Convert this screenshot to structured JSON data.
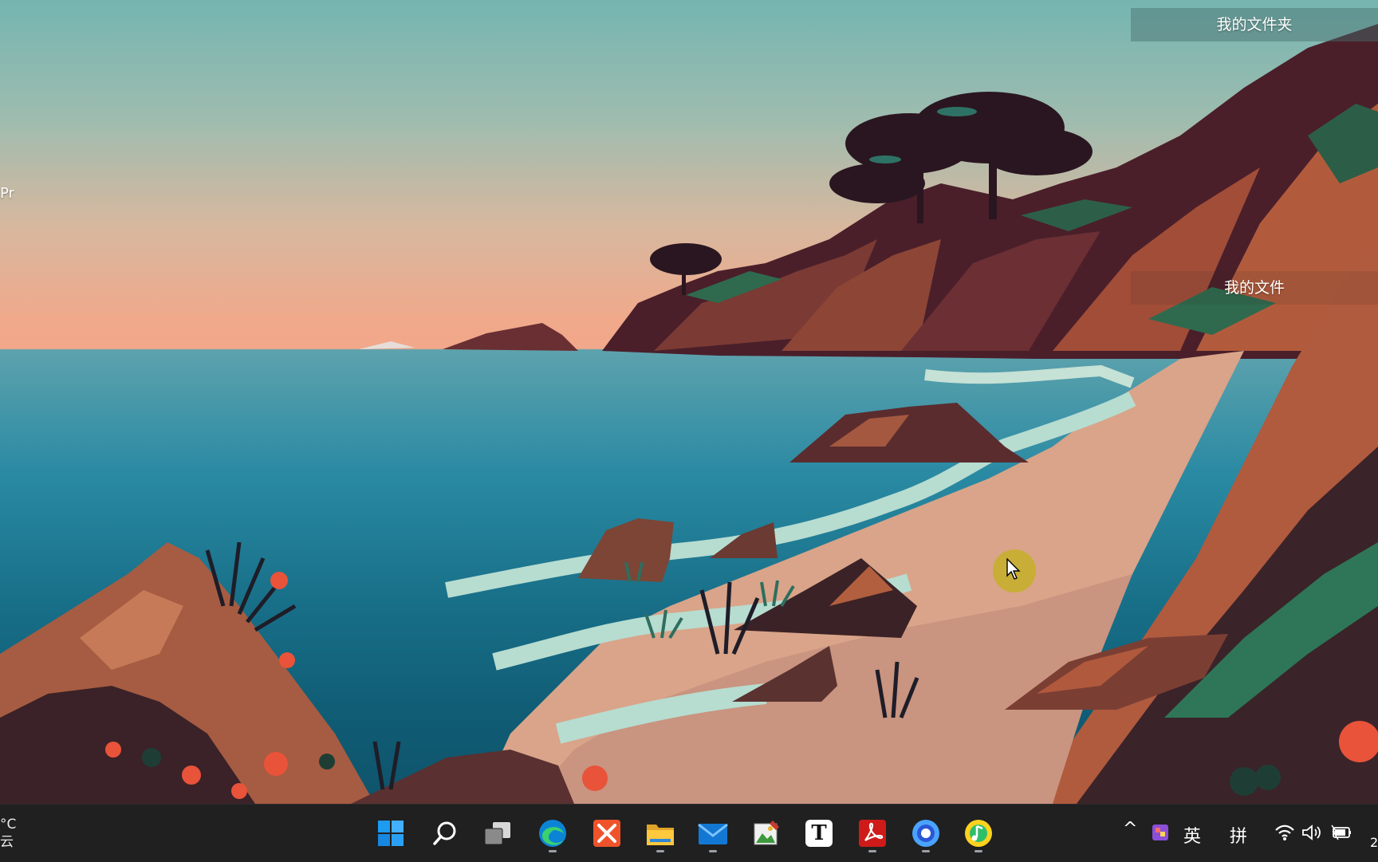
{
  "desktop": {
    "icon_labels": [
      "我的文件夹",
      "我的文件"
    ],
    "edge_label": "Pr"
  },
  "taskbar": {
    "weather": {
      "temp": "°C",
      "condition": "云"
    },
    "pinned_apps": [
      {
        "name": "start",
        "icon": "windows-start-icon"
      },
      {
        "name": "search",
        "icon": "search-icon"
      },
      {
        "name": "task-view",
        "icon": "task-view-icon"
      },
      {
        "name": "edge",
        "icon": "edge-browser-icon"
      },
      {
        "name": "xmind",
        "icon": "xmind-icon"
      },
      {
        "name": "file-explorer",
        "icon": "folder-icon"
      },
      {
        "name": "mail",
        "icon": "mail-icon"
      },
      {
        "name": "photo-editor",
        "icon": "photo-editor-icon"
      },
      {
        "name": "typora",
        "icon": "typora-icon",
        "text": "T"
      },
      {
        "name": "acrobat",
        "icon": "acrobat-icon"
      },
      {
        "name": "app-circle",
        "icon": "blue-circle-app-icon"
      },
      {
        "name": "qq-music",
        "icon": "music-app-icon"
      }
    ],
    "tray": {
      "chevron": "^",
      "ime_lang": "英",
      "ime_mode": "拼",
      "clock_partial": "2"
    }
  }
}
